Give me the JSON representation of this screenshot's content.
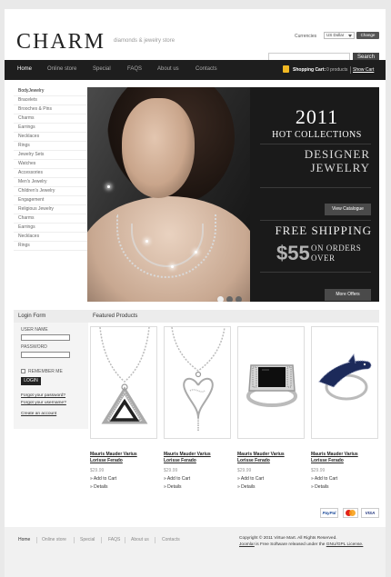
{
  "header": {
    "logo": "CHARM",
    "tagline": "diamonds & jewelry store",
    "currencies_label": "Currencies",
    "currency_value": "US Dollar",
    "change_label": "Change",
    "search_label": "Search"
  },
  "nav": {
    "items": [
      "Home",
      "Online store",
      "Special",
      "FAQS",
      "About us",
      "Contacts"
    ],
    "cart_label": "Shopping Cart:",
    "cart_count": "0 products",
    "show_cart": "Show Cart"
  },
  "sidebar": {
    "categories": [
      "BodyJewelry",
      "Bracelets",
      "Brooches & Pins",
      "Charms",
      "Earrings",
      "Necklaces",
      "Rings",
      "Jewelry Sets",
      "Watches",
      "Accessories",
      "Men's Jewelry",
      "Children's Jewelry",
      "Engagement",
      "Religious Jewelry",
      "Charms",
      "Earrings",
      "Necklaces",
      "Rings"
    ]
  },
  "banner": {
    "year": "2011",
    "hot": "HOT COLLECTIONS",
    "designer_line1": "DESIGNER",
    "designer_line2": "JEWELRY",
    "catalogue_btn": "View Catalogue",
    "free_shipping": "FREE SHIPPING",
    "price": "$55",
    "on_orders": "ON ORDERS",
    "over": "OVER",
    "more_offers_btn": "More Offers",
    "slide_count": 3,
    "active_slide": 1
  },
  "login": {
    "title": "Login Form",
    "username_label": "USER NAME",
    "password_label": "PASSWORD",
    "remember_label": "REMEMBER ME",
    "login_btn": "LOGIN",
    "forgot_password": "Forgot your password?",
    "forgot_username": "Forgot your username?",
    "create_account": "Create an account"
  },
  "featured": {
    "title": "Featured Products",
    "products": [
      {
        "name_line1": "Mauris Mauder Varius",
        "name_line2": "Lorisse Ferado",
        "price": "$29.99",
        "add": "Add to Cart",
        "details": "Details",
        "icon": "triangle-pendant-icon"
      },
      {
        "name_line1": "Mauris Mauder Varius",
        "name_line2": "Lorisse Ferado",
        "price": "$29.99",
        "add": "Add to Cart",
        "details": "Details",
        "icon": "heart-pendant-icon"
      },
      {
        "name_line1": "Mauris Mauder Varius",
        "name_line2": "Lorisse Ferado",
        "price": "$29.99",
        "add": "Add to Cart",
        "details": "Details",
        "icon": "ring-icon"
      },
      {
        "name_line1": "Mauris Mauder Varius",
        "name_line2": "Lorisse Ferado",
        "price": "$29.99",
        "add": "Add to Cart",
        "details": "Details",
        "icon": "dolphin-ring-icon"
      }
    ]
  },
  "payments": {
    "paypal": "PayPal",
    "visa": "VISA"
  },
  "footer": {
    "items": [
      "Home",
      "Online store",
      "Special",
      "FAQS",
      "About us",
      "Contacts"
    ],
    "copyright": "Copyright © 2011 Virtue Mart. All Rights Reserved.",
    "joomla": "Joomla!",
    "license_text": "is Free Software released under the",
    "license": "GNU/GPL License."
  },
  "colors": {
    "nav_bg": "#1e1e1e",
    "cart_icon": "#f1b823",
    "banner_bg": "#1a1a1a"
  }
}
